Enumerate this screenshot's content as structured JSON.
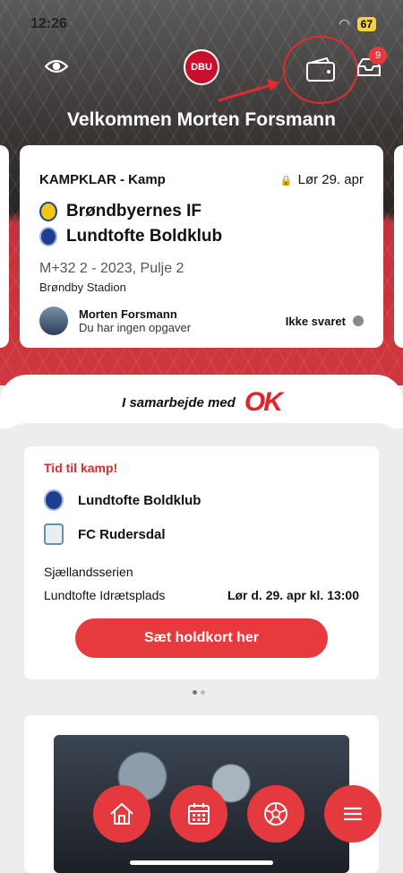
{
  "status_bar": {
    "time": "12:26",
    "battery": "67"
  },
  "header": {
    "logo_text": "DBU",
    "welcome": "Velkommen Morten Forsmann",
    "inbox_badge": "9",
    "icons": [
      "eye-icon",
      "wallet-icon",
      "inbox-icon"
    ]
  },
  "match_card": {
    "status": "KAMPKLAR - Kamp",
    "date": "Lør 29. apr",
    "home_team": "Brøndbyernes IF",
    "away_team": "Lundtofte Boldklub",
    "league": "M+32 2 - 2023, Pulje 2",
    "stadium": "Brøndby Stadion",
    "person_name": "Morten Forsmann",
    "person_note": "Du har ingen opgaver",
    "answer": "Ikke svaret"
  },
  "sponsor": {
    "text": "I samarbejde med",
    "brand": "OK"
  },
  "next_match": {
    "heading": "Tid til kamp!",
    "team1": "Lundtofte Boldklub",
    "team2": "FC Rudersdal",
    "series": "Sjællandsserien",
    "venue": "Lundtofte Idrætsplads",
    "datetime": "Lør d. 29. apr kl. 13:00",
    "button": "Sæt holdkort her"
  },
  "pager": {
    "pages": 2,
    "active": 1
  },
  "bottom_nav": [
    "home-icon",
    "calendar-icon",
    "football-icon",
    "menu-icon"
  ],
  "colors": {
    "accent": "#e4393e",
    "brand_red": "#c8102e"
  }
}
